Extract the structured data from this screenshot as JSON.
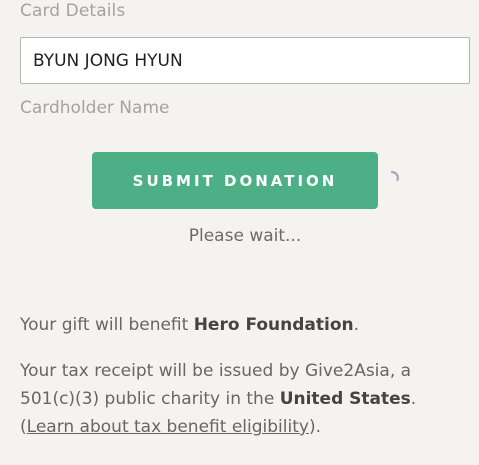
{
  "section": {
    "title": "Card Details"
  },
  "cardholder": {
    "value": "BYUN JONG HYUN",
    "label": "Cardholder Name"
  },
  "submit": {
    "label": "SUBMIT DONATION",
    "status": "Please wait..."
  },
  "benefit": {
    "prefix": "Your gift will benefit ",
    "org": "Hero Foundation",
    "suffix": "."
  },
  "receipt": {
    "prefix": "Your tax receipt will be issued by Give2Asia, a 501(c)(3) public charity in the ",
    "country": "United States",
    "middle": ". (",
    "link_text": "Learn about tax benefit eligibility",
    "suffix": ")."
  },
  "colors": {
    "accent": "#4caf86",
    "background": "#f4f3ef"
  },
  "icons": {
    "spinner": "loading-spinner-icon"
  }
}
